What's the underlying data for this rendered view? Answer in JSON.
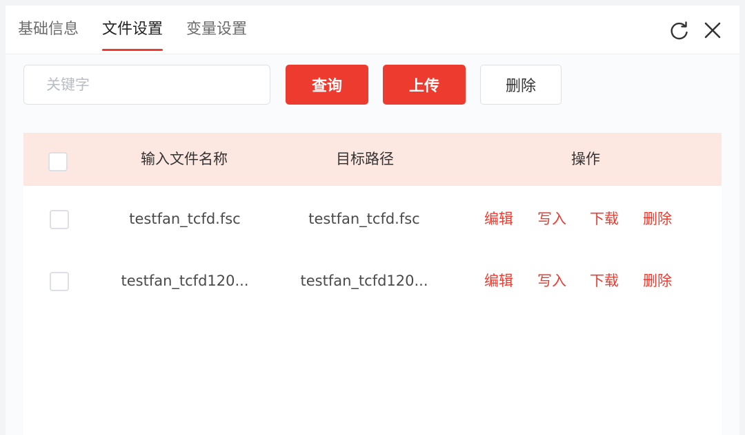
{
  "tabs": [
    "基础信息",
    "文件设置",
    "变量设置"
  ],
  "active_tab": "文件设置",
  "header_icons": [
    "refresh-icon",
    "close-icon"
  ],
  "toolbar": {
    "search_placeholder": "关键字",
    "search_value": "",
    "query_label": "查询",
    "upload_label": "上传",
    "delete_label": "删除"
  },
  "table": {
    "columns": [
      "输入文件名称",
      "目标路径",
      "操作"
    ],
    "rows": [
      {
        "name": "testfan_tcfd.fsc",
        "path": "testfan_tcfd.fsc",
        "actions": [
          "编辑",
          "写入",
          "下载",
          "删除"
        ]
      },
      {
        "name": "testfan_tcfd120...",
        "path": "testfan_tcfd120...",
        "actions": [
          "编辑",
          "写入",
          "下载",
          "删除"
        ]
      }
    ]
  },
  "colors": {
    "accent": "#ee3b2f",
    "header_row_bg": "#fde8e1"
  }
}
